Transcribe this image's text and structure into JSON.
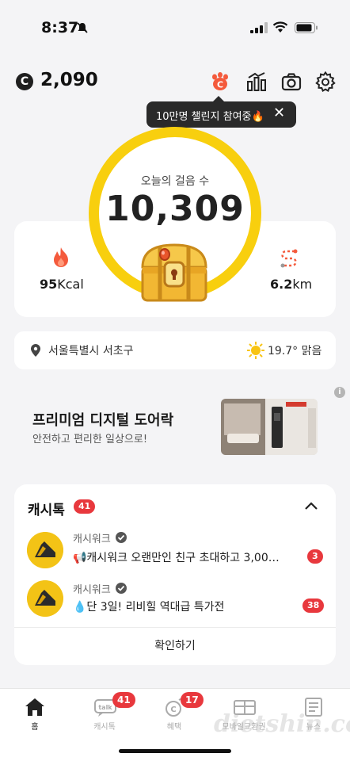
{
  "status_bar": {
    "time": "8:37"
  },
  "header": {
    "coin_symbol": "C",
    "coin_balance": "2,090",
    "icons": [
      "paw-icon",
      "chart-icon",
      "camera-icon",
      "gear-icon"
    ]
  },
  "tooltip": {
    "text": "10만명 챌린지 참여중🔥",
    "close": "✕"
  },
  "steps": {
    "label": "오늘의 걸음 수",
    "value": "10,309"
  },
  "stats": {
    "kcal_value": "95",
    "kcal_unit": "Kcal",
    "distance_value": "6.2",
    "distance_unit": "km"
  },
  "location": {
    "place": "서울특별시 서초구",
    "weather": "19.7° 맑음"
  },
  "ad": {
    "title": "프리미엄 디지털 도어락",
    "subtitle": "안전하고 편리한 일상으로!",
    "info": "i"
  },
  "cashtalk": {
    "title": "캐시톡",
    "badge": "41",
    "messages": [
      {
        "sender": "캐시워크",
        "text": "📢캐시워크 오랜만인 친구 초대하고 3,00…",
        "count": "3"
      },
      {
        "sender": "캐시워크",
        "text": "💧단 3일! 리비힐 역대급 특가전",
        "count": "38"
      }
    ],
    "confirm_label": "확인하기"
  },
  "tabs": [
    {
      "label": "홈",
      "badge": ""
    },
    {
      "label": "캐시톡",
      "badge": "41"
    },
    {
      "label": "혜택",
      "badge": "17"
    },
    {
      "label": "모바일교환권",
      "badge": ""
    },
    {
      "label": "뉴스",
      "badge": ""
    }
  ],
  "watermark": "dietshin.com",
  "colors": {
    "accent_yellow": "#f8cf0e",
    "badge_red": "#e8383d",
    "flame": "#f45a3c"
  }
}
